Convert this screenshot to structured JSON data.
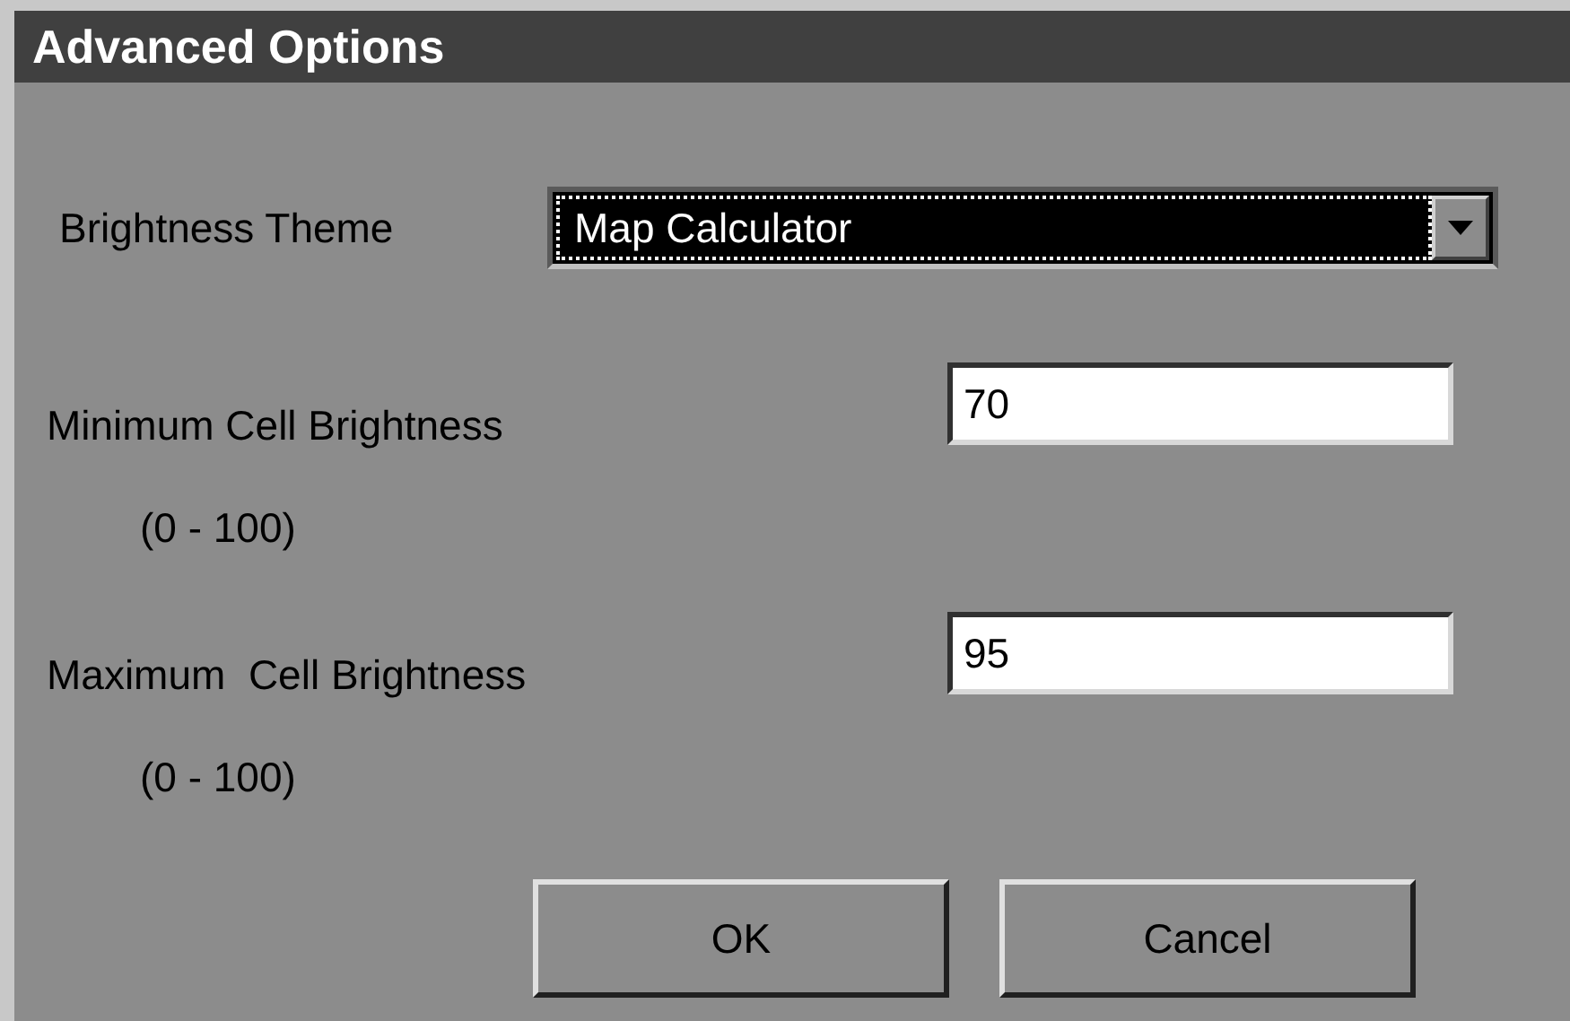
{
  "window": {
    "title": "Advanced Options"
  },
  "brightness_theme": {
    "label": "Brightness Theme",
    "value": "Map Calculator",
    "focused": true
  },
  "fields": [
    {
      "label": "Minimum Cell Brightness",
      "range": "(0 - 100)",
      "value": "70"
    },
    {
      "label": "Maximum  Cell Brightness",
      "range": "(0 - 100)",
      "value": "95"
    }
  ],
  "buttons": [
    "OK",
    "Cancel"
  ]
}
